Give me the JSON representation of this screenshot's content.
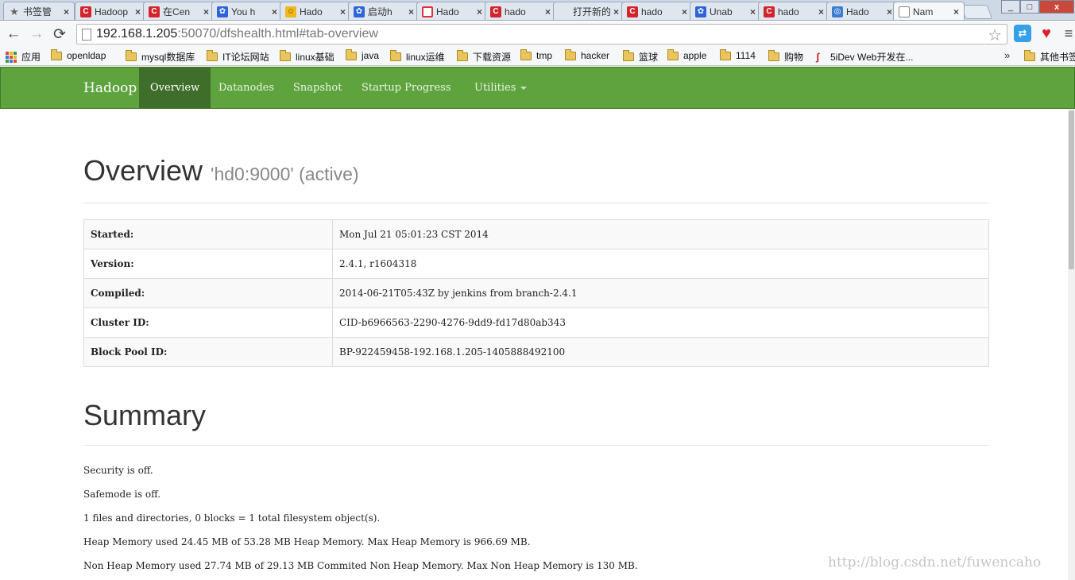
{
  "browser": {
    "tabs": [
      {
        "title": "书签管",
        "icon": "star-icon"
      },
      {
        "title": "Hadoop",
        "icon": "csdn-icon"
      },
      {
        "title": "在Cen",
        "icon": "csdn-icon"
      },
      {
        "title": "You h",
        "icon": "baidu-paw-icon"
      },
      {
        "title": "Hado",
        "icon": "smiley-icon"
      },
      {
        "title": "启动h",
        "icon": "baidu-paw-icon"
      },
      {
        "title": "Hado",
        "icon": "circle-icon"
      },
      {
        "title": "hado",
        "icon": "csdn-icon"
      },
      {
        "title": "打开新的",
        "icon": "blank-icon"
      },
      {
        "title": "hado",
        "icon": "csdn-icon"
      },
      {
        "title": "Unab",
        "icon": "baidu-paw-icon"
      },
      {
        "title": "hado",
        "icon": "csdn-icon"
      },
      {
        "title": "Hado",
        "icon": "globe-icon"
      },
      {
        "title": "Nam",
        "icon": "page-icon",
        "active": true
      }
    ],
    "close_glyph": "×",
    "window_controls": {
      "minimize": "_",
      "maximize": "□",
      "close": "x"
    },
    "url": {
      "host": "192.168.1.205",
      "rest": ":50070/dfshealth.html#tab-overview"
    },
    "nav_glyphs": {
      "back": "←",
      "forward": "→",
      "reload": "⟳",
      "star": "☆",
      "heart": "♥",
      "menu": "≡",
      "ext": "⇄"
    },
    "bookmarks": [
      {
        "label": "应用",
        "type": "apps"
      },
      {
        "label": "openldap",
        "type": "folder"
      },
      {
        "label": "mysql数据库",
        "type": "folder"
      },
      {
        "label": "IT论坛网站",
        "type": "folder"
      },
      {
        "label": "linux基础",
        "type": "folder"
      },
      {
        "label": "java",
        "type": "folder"
      },
      {
        "label": "linux运维",
        "type": "folder"
      },
      {
        "label": "下载资源",
        "type": "folder"
      },
      {
        "label": "tmp",
        "type": "folder"
      },
      {
        "label": "hacker",
        "type": "folder"
      },
      {
        "label": "篮球",
        "type": "folder"
      },
      {
        "label": "apple",
        "type": "folder"
      },
      {
        "label": "1114",
        "type": "folder"
      },
      {
        "label": "购物",
        "type": "folder"
      },
      {
        "label": "5iDev Web开发在...",
        "type": "site"
      }
    ],
    "bookmarks_overflow": "»",
    "other_bookmarks": "其他书签"
  },
  "nav": {
    "brand": "Hadoop",
    "items": [
      {
        "label": "Overview",
        "active": true
      },
      {
        "label": "Datanodes"
      },
      {
        "label": "Snapshot"
      },
      {
        "label": "Startup Progress"
      },
      {
        "label": "Utilities",
        "dropdown": true
      }
    ]
  },
  "overview": {
    "title": "Overview",
    "subtitle": "'hd0:9000' (active)",
    "rows": [
      {
        "key": "Started:",
        "value": "Mon Jul 21 05:01:23 CST 2014"
      },
      {
        "key": "Version:",
        "value": "2.4.1, r1604318"
      },
      {
        "key": "Compiled:",
        "value": "2014-06-21T05:43Z by jenkins from branch-2.4.1"
      },
      {
        "key": "Cluster ID:",
        "value": "CID-b6966563-2290-4276-9dd9-fd17d80ab343"
      },
      {
        "key": "Block Pool ID:",
        "value": "BP-922459458-192.168.1.205-1405888492100"
      }
    ]
  },
  "summary": {
    "title": "Summary",
    "lines": [
      "Security is off.",
      "Safemode is off.",
      "1 files and directories, 0 blocks = 1 total filesystem object(s).",
      "Heap Memory used 24.45 MB of 53.28 MB Heap Memory. Max Heap Memory is 966.69 MB.",
      "Non Heap Memory used 27.74 MB of 29.13 MB Commited Non Heap Memory. Max Non Heap Memory is 130 MB."
    ]
  },
  "watermark": "http://blog.csdn.net/fuwencaho",
  "colors": {
    "navbar": "#5fa33e",
    "navbar_active": "#3f6e2b",
    "csdn_red": "#d3242c",
    "baidu_blue": "#2e64d8"
  }
}
